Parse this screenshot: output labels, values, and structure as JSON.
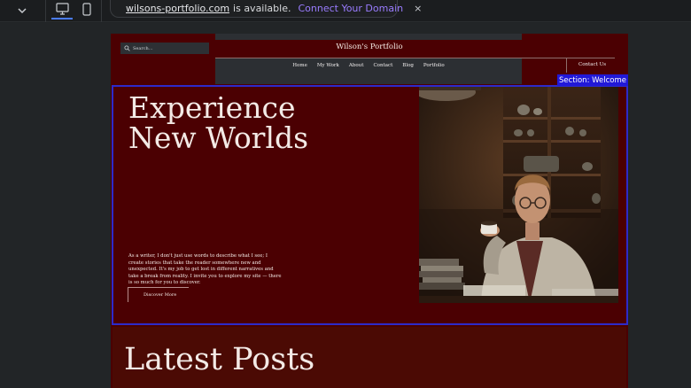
{
  "editor": {
    "domain_name": "wilsons-portfolio.com",
    "domain_status": "is available.",
    "connect_label": "Connect Your Domain",
    "close_glyph": "×"
  },
  "site": {
    "search_placeholder": "Search...",
    "title": "Wilson's Portfolio",
    "nav": [
      "Home",
      "My Work",
      "About",
      "Contact",
      "Blog",
      "Portfolio"
    ],
    "contact_button": "Contact Us"
  },
  "section_tag": "Section: Welcome",
  "hero": {
    "title_line1": "Experience",
    "title_line2": "New Worlds",
    "body": "As a writer, I don't just use words to describe what I see; I create stories that take the reader somewhere new and unexpected. It's my job to get lost in different narratives and take a break from reality. I invite you to explore my site — there is so much for you to discover.",
    "button": "Discover More"
  },
  "posts": {
    "title": "Latest Posts"
  },
  "colors": {
    "site_bg": "#4b0002",
    "selection": "#2d2acb",
    "connect_accent": "#9a7cff"
  },
  "icons": [
    "chevron-down-icon",
    "desktop-icon",
    "mobile-icon",
    "globe-icon",
    "close-icon",
    "search-icon"
  ]
}
